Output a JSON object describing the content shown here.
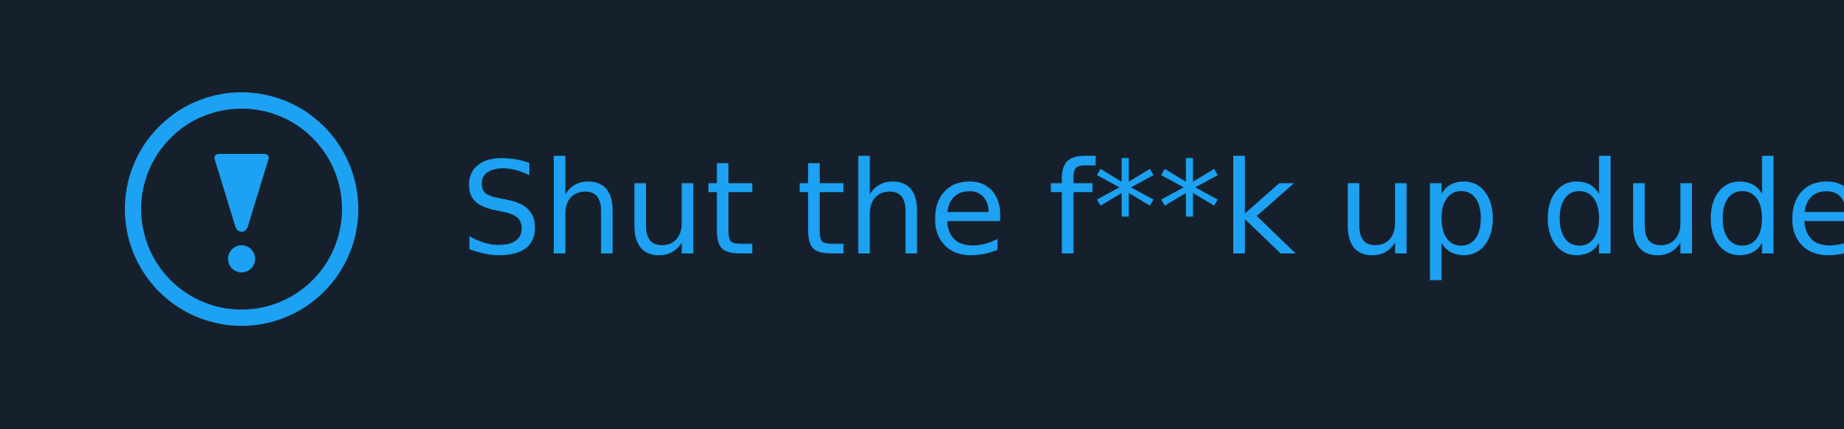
{
  "theme": {
    "background": "#16202c",
    "accent": "#1da1f2"
  },
  "alert": {
    "icon": "exclamation-circle-icon",
    "message": "Shut the f**k up dude"
  }
}
